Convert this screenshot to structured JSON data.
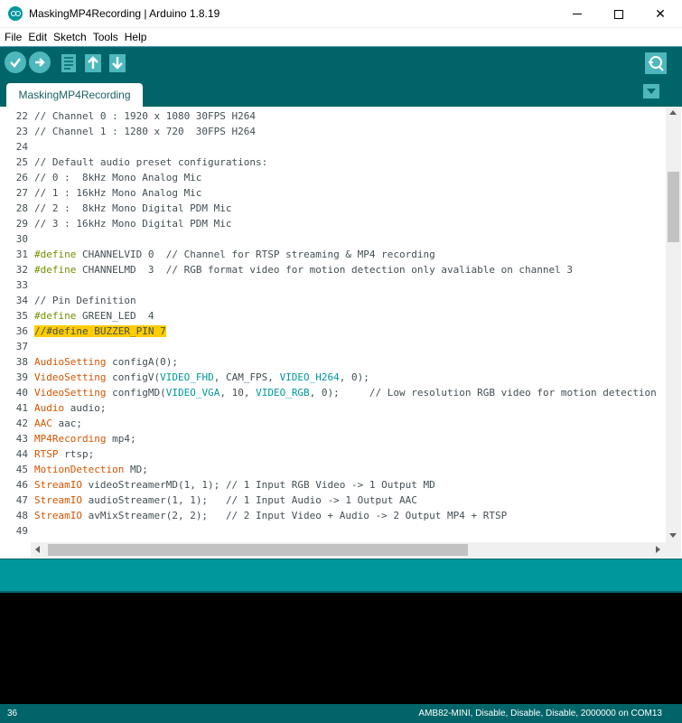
{
  "window": {
    "title": "MaskingMP4Recording | Arduino 1.8.19",
    "minimize_glyph": "",
    "close_glyph": "✕"
  },
  "menu": [
    "File",
    "Edit",
    "Sketch",
    "Tools",
    "Help"
  ],
  "toolbar": {
    "buttons": [
      "verify-icon",
      "upload-icon",
      "new-icon",
      "open-icon",
      "save-icon",
      "serial-monitor-icon"
    ]
  },
  "tabs": [
    {
      "label": "MaskingMP4Recording"
    }
  ],
  "editor": {
    "lines": [
      {
        "n": "22",
        "html": "<span class=\"cmt\">// Channel 0 : 1920 x 1080 30FPS H264</span>"
      },
      {
        "n": "23",
        "html": "<span class=\"cmt\">// Channel 1 : 1280 x 720  30FPS H264</span>"
      },
      {
        "n": "24",
        "html": ""
      },
      {
        "n": "25",
        "html": "<span class=\"cmt\">// Default audio preset configurations:</span>"
      },
      {
        "n": "26",
        "html": "<span class=\"cmt\">// 0 :  8kHz Mono Analog Mic</span>"
      },
      {
        "n": "27",
        "html": "<span class=\"cmt\">// 1 : 16kHz Mono Analog Mic</span>"
      },
      {
        "n": "28",
        "html": "<span class=\"cmt\">// 2 :  8kHz Mono Digital PDM Mic</span>"
      },
      {
        "n": "29",
        "html": "<span class=\"cmt\">// 3 : 16kHz Mono Digital PDM Mic</span>"
      },
      {
        "n": "30",
        "html": ""
      },
      {
        "n": "31",
        "html": "<span class=\"pp\">#define</span> CHANNELVID 0  <span class=\"cmt\">// Channel for RTSP streaming &amp; MP4 recording</span>"
      },
      {
        "n": "32",
        "html": "<span class=\"pp\">#define</span> CHANNELMD  3  <span class=\"cmt\">// RGB format video for motion detection only avaliable on channel 3</span>"
      },
      {
        "n": "33",
        "html": ""
      },
      {
        "n": "34",
        "html": "<span class=\"cmt\">// Pin Definition</span>"
      },
      {
        "n": "35",
        "html": "<span class=\"pp\">#define</span> GREEN_LED  4"
      },
      {
        "n": "36",
        "html": "<span class=\"hl\">//#define BUZZER_PIN 7</span>"
      },
      {
        "n": "37",
        "html": ""
      },
      {
        "n": "38",
        "html": "<span class=\"kw\">AudioSetting</span> configA(0);"
      },
      {
        "n": "39",
        "html": "<span class=\"kw\">VideoSetting</span> configV(<span class=\"cst\">VIDEO_FHD</span>, CAM_FPS, <span class=\"cst\">VIDEO_H264</span>, 0);"
      },
      {
        "n": "40",
        "html": "<span class=\"kw\">VideoSetting</span> configMD(<span class=\"cst\">VIDEO_VGA</span>, 10, <span class=\"cst\">VIDEO_RGB</span>, 0);     <span class=\"cmt\">// Low resolution RGB video for motion detection</span>"
      },
      {
        "n": "41",
        "html": "<span class=\"kw\">Audio</span> audio;"
      },
      {
        "n": "42",
        "html": "<span class=\"kw\">AAC</span> aac;"
      },
      {
        "n": "43",
        "html": "<span class=\"kw\">MP4Recording</span> mp4;"
      },
      {
        "n": "44",
        "html": "<span class=\"kw\">RTSP</span> rtsp;"
      },
      {
        "n": "45",
        "html": "<span class=\"kw\">MotionDetection</span> MD;"
      },
      {
        "n": "46",
        "html": "<span class=\"kw\">StreamIO</span> videoStreamerMD(1, 1); <span class=\"cmt\">// 1 Input RGB Video -&gt; 1 Output MD</span>"
      },
      {
        "n": "47",
        "html": "<span class=\"kw\">StreamIO</span> audioStreamer(1, 1);   <span class=\"cmt\">// 1 Input Audio -&gt; 1 Output AAC</span>"
      },
      {
        "n": "48",
        "html": "<span class=\"kw\">StreamIO</span> avMixStreamer(2, 2);   <span class=\"cmt\">// 2 Input Video + Audio -&gt; 2 Output MP4 + RTSP</span>"
      },
      {
        "n": "49",
        "html": ""
      }
    ]
  },
  "status": {
    "line_number": "36",
    "board_info": "AMB82-MINI, Disable, Disable, Disable, 2000000 on COM13"
  },
  "colors": {
    "toolbar": "#006468",
    "accent": "#00979c",
    "button": "#4db7bb",
    "highlight": "#ffcc00",
    "keyword": "#d35400",
    "constant": "#00979c",
    "preprocessor": "#728e00"
  }
}
